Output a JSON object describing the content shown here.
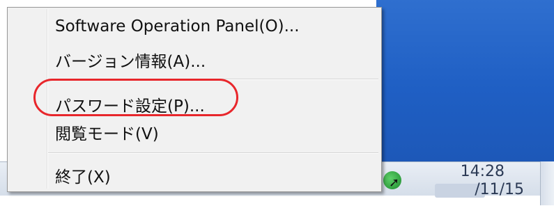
{
  "menu": {
    "items": [
      {
        "label": "Software Operation Panel(O)..."
      },
      {
        "label": "バージョン情報(A)..."
      },
      {
        "label": "パスワード設定(P)..."
      },
      {
        "label": "閲覧モード(V)"
      },
      {
        "label": "終了(X)"
      }
    ]
  },
  "taskbar": {
    "clock_time": "14:28",
    "clock_date": "/11/15"
  },
  "colors": {
    "highlight_ring": "#e8262b",
    "desktop": "#1f5fc4"
  }
}
